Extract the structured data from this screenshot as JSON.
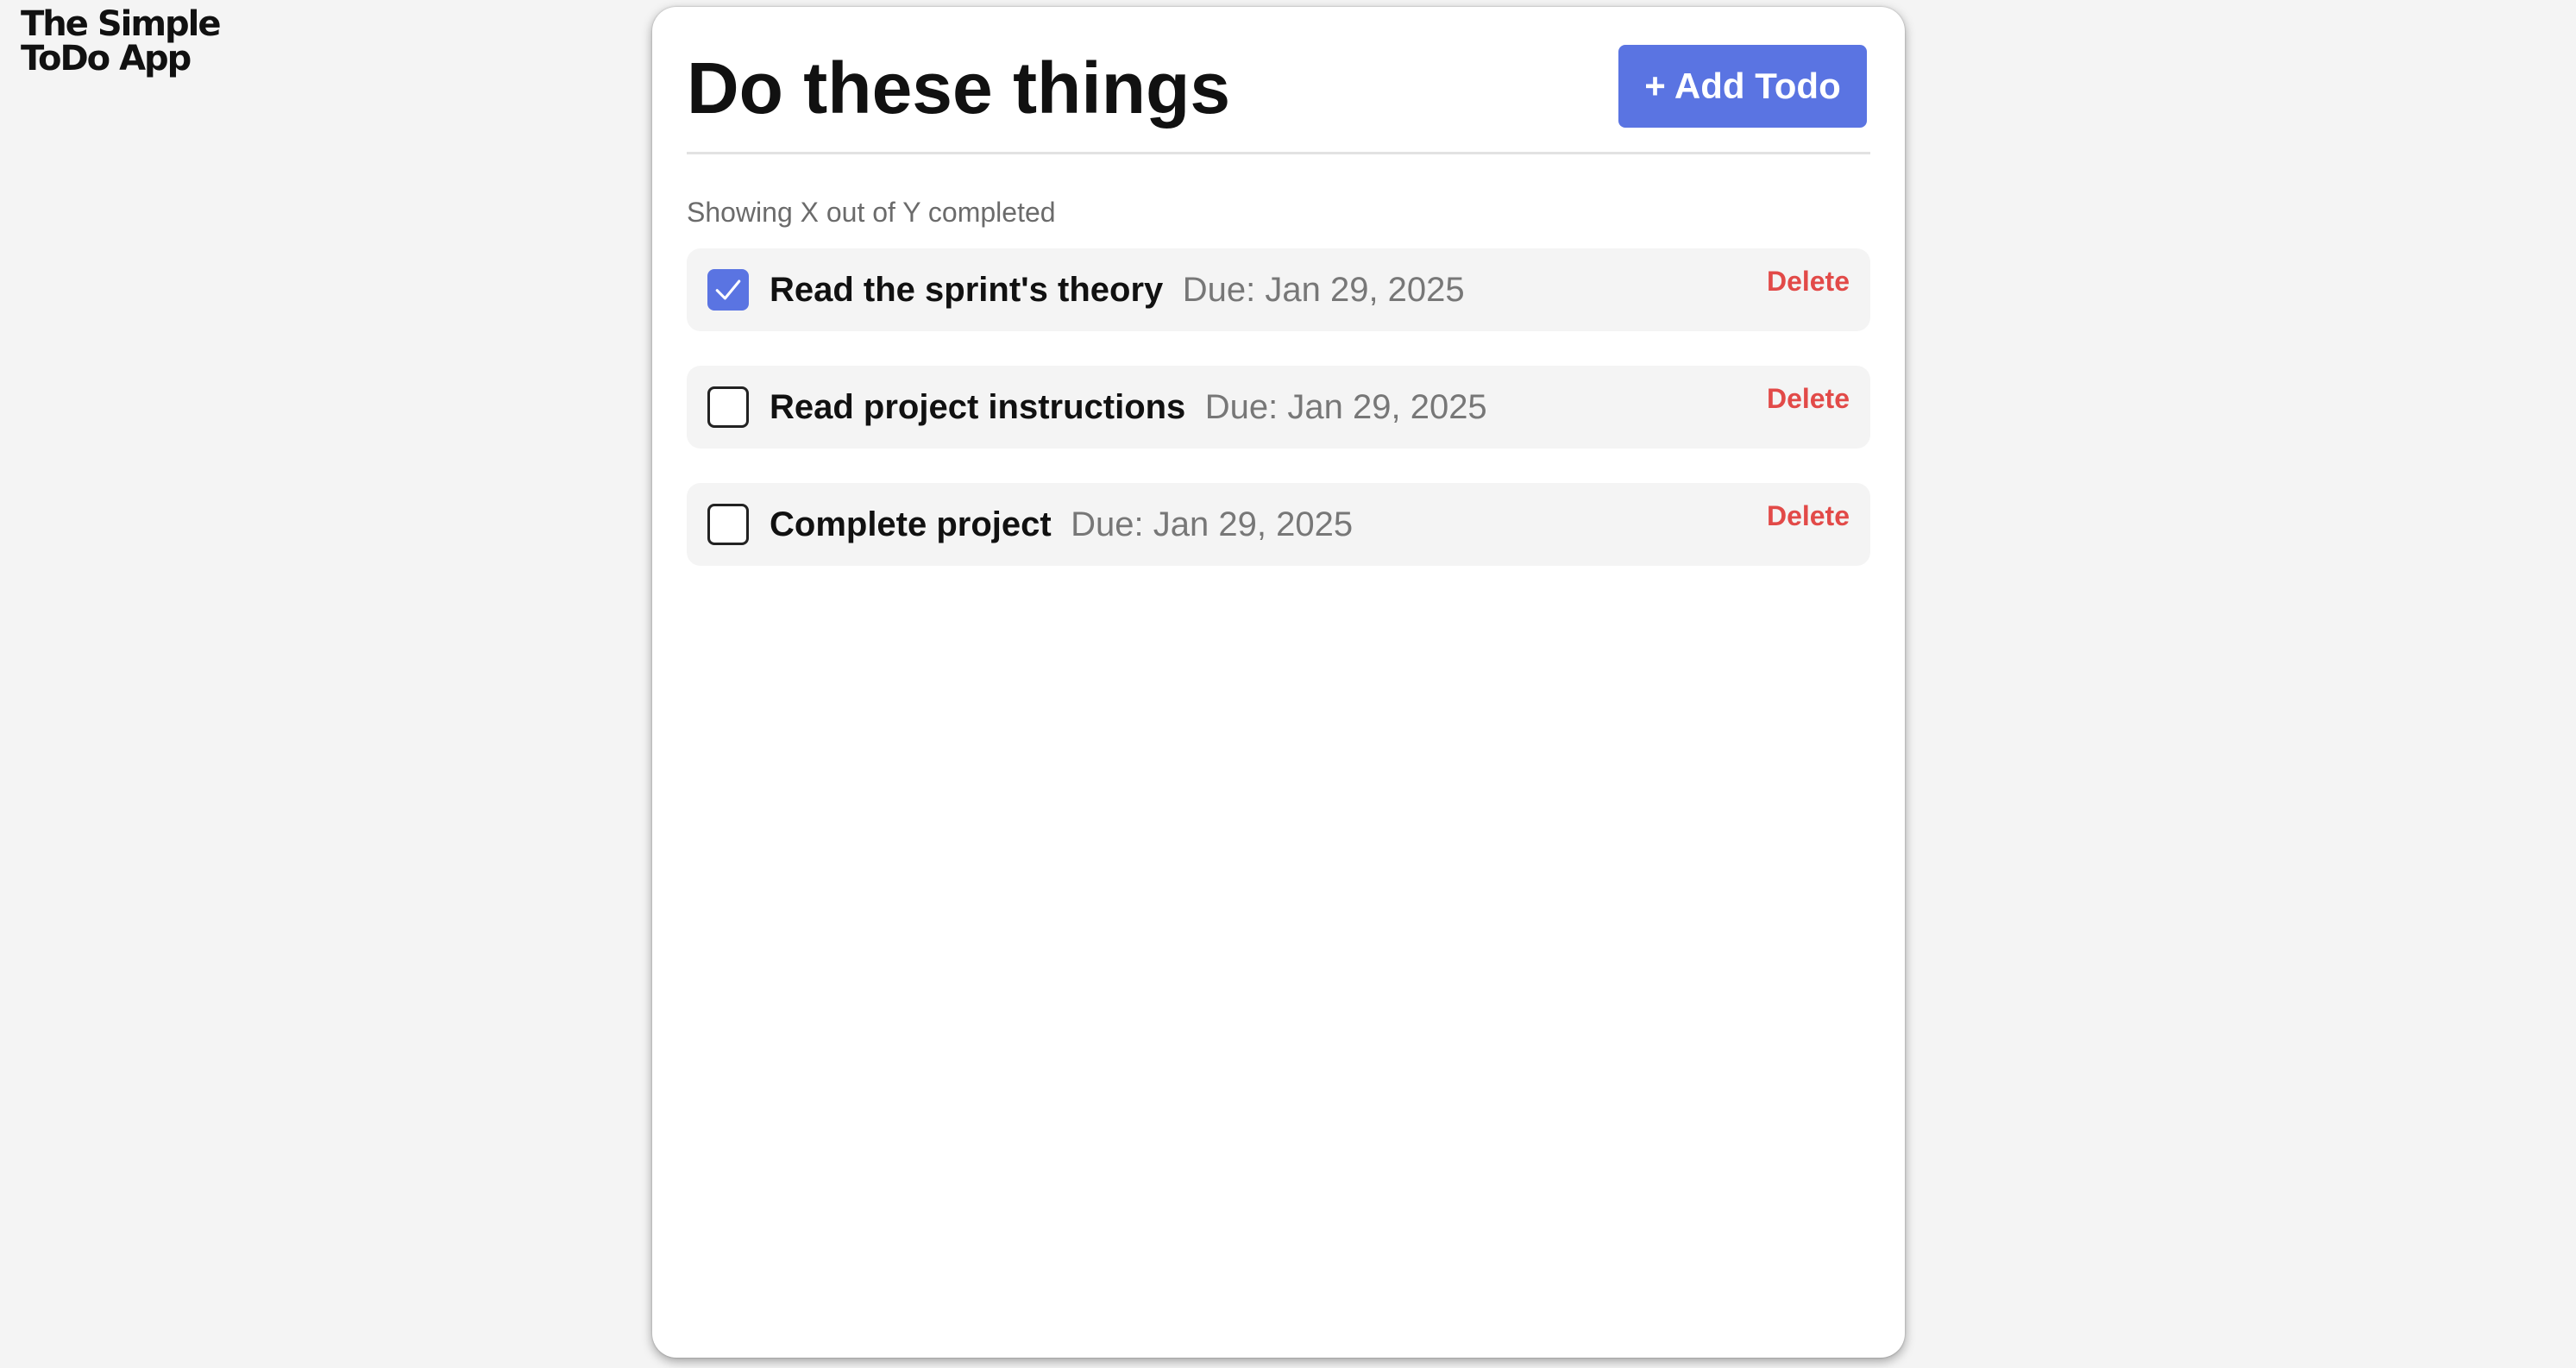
{
  "app": {
    "logo_line1": "The Simple",
    "logo_line2": "ToDo App"
  },
  "header": {
    "title": "Do these things",
    "add_button_label": "+ Add Todo"
  },
  "summary": "Showing X out of Y completed",
  "todos": [
    {
      "title": "Read the sprint's theory",
      "due": "Due: Jan 29, 2025",
      "completed": true,
      "delete_label": "Delete"
    },
    {
      "title": "Read project instructions",
      "due": "Due: Jan 29, 2025",
      "completed": false,
      "delete_label": "Delete"
    },
    {
      "title": "Complete project",
      "due": "Due: Jan 29, 2025",
      "completed": false,
      "delete_label": "Delete"
    }
  ],
  "colors": {
    "accent": "#5a74e2",
    "danger": "#e24a48",
    "background": "#f4f4f4",
    "card": "#ffffff"
  },
  "icons": {
    "checkbox_checked": "checkmark-icon"
  }
}
